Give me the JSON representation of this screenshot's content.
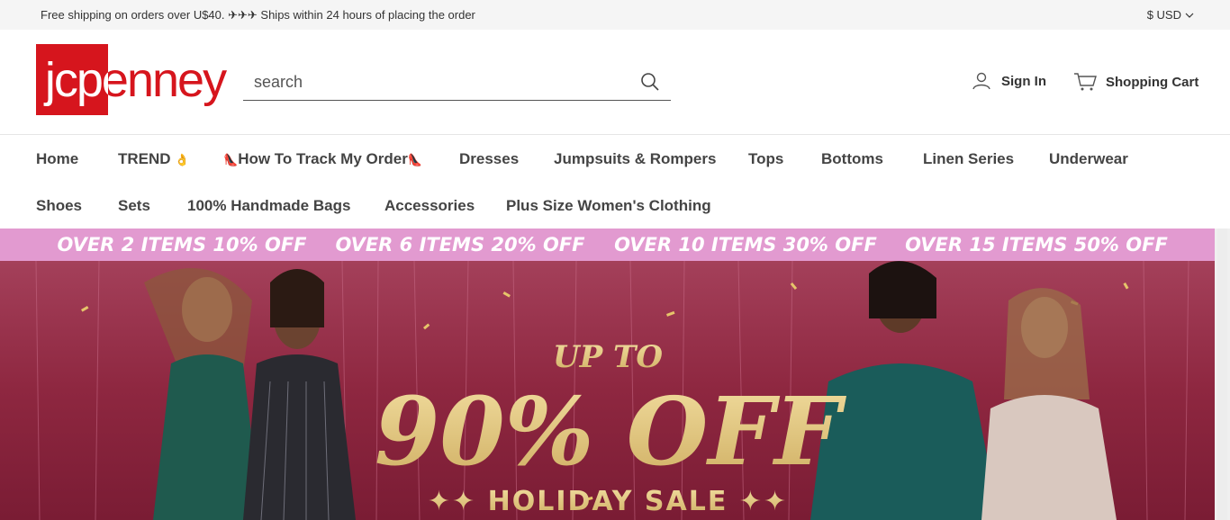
{
  "topbar": {
    "promo": "Free shipping on orders over U$40. ✈✈✈ Ships within 24 hours of placing the order",
    "currency": "$ USD"
  },
  "header": {
    "logo_text": "jcpenney",
    "search_placeholder": "search",
    "sign_in": "Sign In",
    "cart": "Shopping Cart"
  },
  "nav": {
    "row1": [
      {
        "label": "Home"
      },
      {
        "label": "TREND",
        "emoji": "👌"
      },
      {
        "label": "How To Track My Order",
        "shoe": "👠"
      },
      {
        "label": "Dresses"
      },
      {
        "label": "Jumpsuits & Rompers"
      },
      {
        "label": "Tops"
      },
      {
        "label": "Bottoms"
      },
      {
        "label": "Linen Series"
      },
      {
        "label": "Underwear"
      }
    ],
    "row2": [
      {
        "label": "Shoes"
      },
      {
        "label": "Sets"
      },
      {
        "label": "100% Handmade Bags"
      },
      {
        "label": "Accessories"
      },
      {
        "label": "Plus Size Women's Clothing"
      }
    ]
  },
  "banner": {
    "tiers": [
      "OVER 2 ITEMS 10% OFF",
      "OVER 6 ITEMS 20% OFF",
      "OVER 10 ITEMS 30% OFF",
      "OVER 15 ITEMS 50% OFF"
    ],
    "up_to": "UP TO",
    "discount": "90% OFF",
    "sale": "✦✦ HOLIDAY SALE ✦✦"
  },
  "colors": {
    "brand_red": "#d6151d",
    "tier_strip": "#e29ad0",
    "banner_bg": "#8e2740",
    "gold": "#e9cf8e"
  }
}
